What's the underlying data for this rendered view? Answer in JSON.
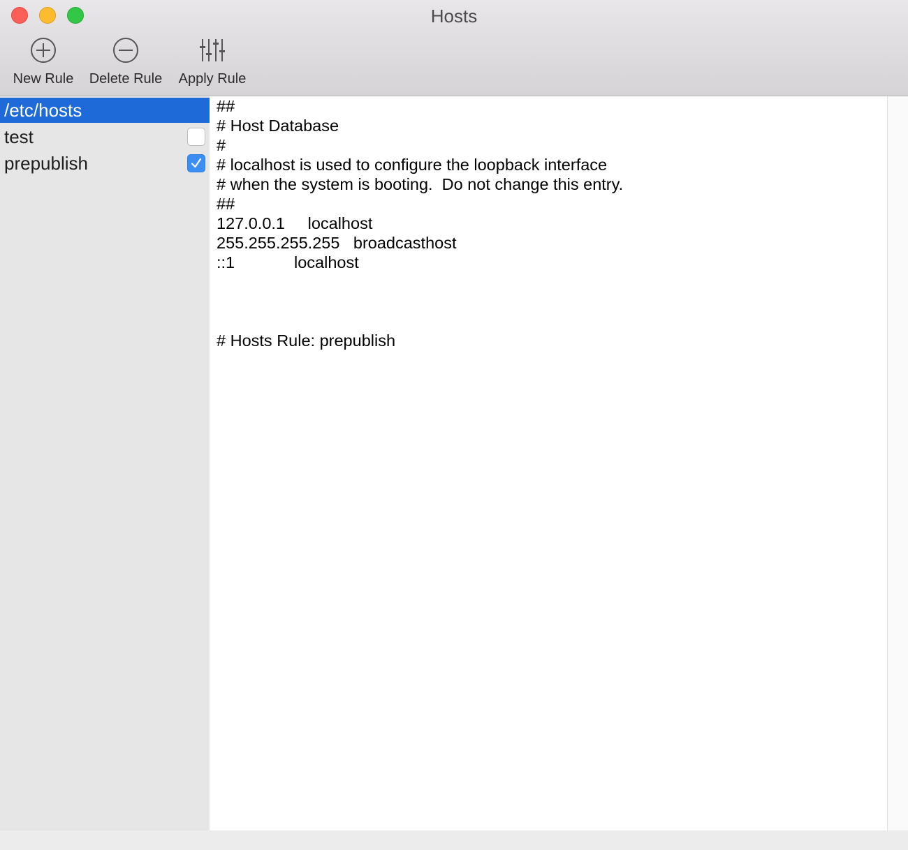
{
  "window": {
    "title": "Hosts"
  },
  "toolbar": {
    "new_rule": "New Rule",
    "delete_rule": "Delete Rule",
    "apply_rule": "Apply Rule"
  },
  "sidebar": {
    "items": [
      {
        "label": "/etc/hosts",
        "selected": true,
        "has_checkbox": false
      },
      {
        "label": "test",
        "selected": false,
        "has_checkbox": true,
        "checked": false
      },
      {
        "label": "prepublish",
        "selected": false,
        "has_checkbox": true,
        "checked": true
      }
    ]
  },
  "editor": {
    "content": "##\n# Host Database\n#\n# localhost is used to configure the loopback interface\n# when the system is booting.  Do not change this entry.\n##\n127.0.0.1\tlocalhost\n255.255.255.255\tbroadcasthost\n::1             localhost\n\n\n\n# Hosts Rule: prepublish"
  },
  "colors": {
    "selection": "#1f6ad9",
    "checkbox_checked": "#3c8ef3",
    "close": "#fc5f57",
    "minimize": "#fdbc2e",
    "zoom": "#33c748"
  },
  "icons": {
    "new_rule": "plus-circle-icon",
    "delete_rule": "minus-circle-icon",
    "apply_rule": "sliders-icon"
  }
}
